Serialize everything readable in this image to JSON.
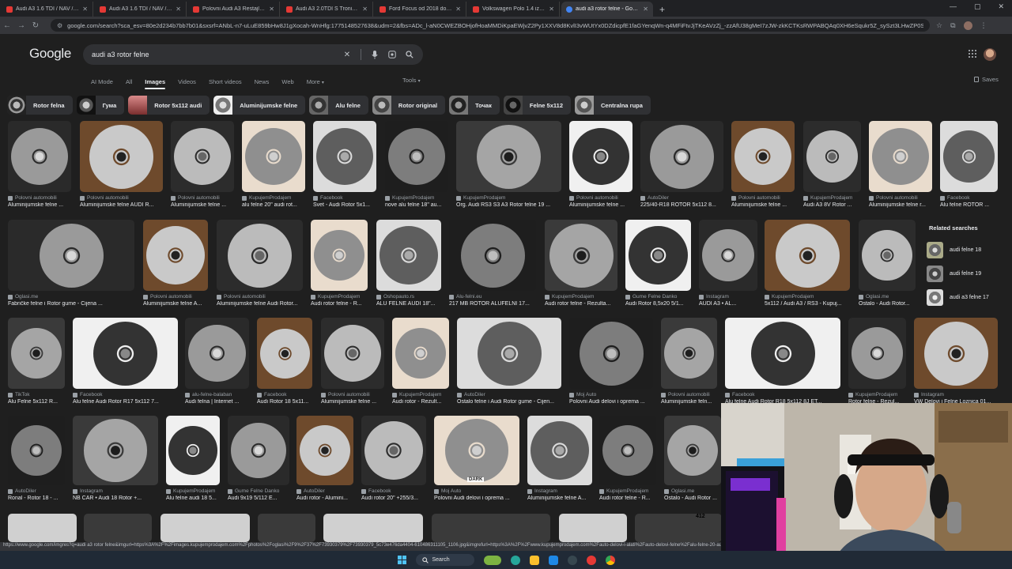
{
  "browser": {
    "tabs": [
      {
        "title": "Audi A3 1.6 TDI / NAV / XEN | P",
        "active": false
      },
      {
        "title": "Audi A3 1.6 TDI / NAV / XEN | P",
        "active": false
      },
      {
        "title": "Polovni Audi A3 Restajling 2019",
        "active": false
      },
      {
        "title": "Audi A3 2.0TDI S Tronic | Polov",
        "active": false
      },
      {
        "title": "Ford Focus od 2018 do 2024 | P",
        "active": false
      },
      {
        "title": "Volkswagen Polo 1.4 iz Nem ad",
        "active": false
      },
      {
        "title": "audi a3 rotor felne - Google Se",
        "active": true
      }
    ],
    "url": "google.com/search?sca_esv=80e2d234b7bb7b01&sxsrf=ANbL-n7-uLuE859bHw8J1gXocah-WnHfg:1775148527638&udm=2&fbs=ADc_l-aN0CWEZBOHjofHoaMMDiKpaEWjvZ2Py1XXV8d8KvlI3vWUtYx0DZdicpfE1faGYenqWn-q4MFiFtvJjTKeAVzZj_-zzAfU38gMeI7zJW-zkKCTKsRWPABQAq0XH6eSqukr5Z_sySzt3LHwZP0SOsVx43I12rWo_IK1Qfo6r2JPnSku",
    "status_url": "https://www.google.com/imgres?q=audi a3 rotor felne&imgurl=https%3A%2F%2Fimages.kupujemprodajem.com%2Fphotos%2Foglasi%2F9%2F37%2F73930379%2F73930379_5c73e476da4404-610486311105_1106.jpg&imgrefurl=https%3A%2F%2Fwww.kupujemprodajem.com%2Fauto-delovi-i-alati%2Fauto-delovi-felne%2Falu-felne-20-audi-rotor"
  },
  "google": {
    "logo": "Google",
    "query": "audi a3 rotor felne",
    "filters": [
      "AI Mode",
      "All",
      "Images",
      "Videos",
      "Short videos",
      "News",
      "Web",
      "More"
    ],
    "active_filter": "Images",
    "tools": "Tools",
    "saves": "Saves",
    "chips": [
      "Rotor felna",
      "Гума",
      "Rotor 5x112 audi",
      "Aluminijumske felne",
      "Alu felne",
      "Rotor original",
      "Точак",
      "Felne 5x112",
      "Centralna rupa"
    ],
    "related_title": "Related searches",
    "related": [
      "audi felne 18",
      "audi felne 19",
      "audi a3 felne 17"
    ]
  },
  "results": [
    {
      "src": "Polovni automobili",
      "title": "Aluminijumske felne ..."
    },
    {
      "src": "Polovni automobili",
      "title": "Aluminijumske felne AUDI R..."
    },
    {
      "src": "Polovni automobili",
      "title": "Aluminijumske felne ..."
    },
    {
      "src": "KupujemProdajem",
      "title": "alu felne 20\" audi rot..."
    },
    {
      "src": "Facebook",
      "title": "Svet - Audi Rotor 5x1..."
    },
    {
      "src": "KupujemProdajem",
      "title": "nove alu felne 18\" au..."
    },
    {
      "src": "KupujemProdajem",
      "title": "Org. Audi RS3 S3 A3 Rotor felne 19 ..."
    },
    {
      "src": "Polovni automobili",
      "title": "Aluminijumske felne ..."
    },
    {
      "src": "AutoDiler",
      "title": "225/40-R18 ROTOR 5x112 8..."
    },
    {
      "src": "Polovni automobili",
      "title": "Aluminijumske felne ..."
    },
    {
      "src": "KupujemProdajem",
      "title": "Audi A3 8V Rotor ..."
    },
    {
      "src": "Polovni automobili",
      "title": "Aluminijumske felne r..."
    },
    {
      "src": "Facebook",
      "title": "Alu felne ROTOR ..."
    },
    {
      "src": "Oglasi.me",
      "title": "Fabričke felne i Rotor gume - Cijena ..."
    },
    {
      "src": "Polovni automobili",
      "title": "Aluminijumske felne A..."
    },
    {
      "src": "Polovni automobili",
      "title": "Aluminijumske felne Audi Rotor..."
    },
    {
      "src": "KupujemProdajem",
      "title": "Audi rotor felne - R..."
    },
    {
      "src": "Oshopauto.rs",
      "title": "ALU FELNE AUDI 18\"..."
    },
    {
      "src": "Alu-felni.eu",
      "title": "217 MB ROTOR ALUFELNI 17..."
    },
    {
      "src": "KupujemProdajem",
      "title": "Audi rotor felne - Rezulta..."
    },
    {
      "src": "Gume Felne Danko",
      "title": "Audi Rotor 8,5x20 5/1..."
    },
    {
      "src": "Instagram",
      "title": "AUDI A3 • AL..."
    },
    {
      "src": "KupujemProdajem",
      "title": "5x112 / Audi A3 / RS3 - Kupuj..."
    },
    {
      "src": "Oglasi.me",
      "title": "Ostalo - Audi Rotor..."
    },
    {
      "src": "TikTok",
      "title": "Alu Felne 5x112 R..."
    },
    {
      "src": "Facebook",
      "title": "Alu felne Audi Rotor R17 5x112 7..."
    },
    {
      "src": "alu-felne-balaban",
      "title": "Audi felna | Internet ..."
    },
    {
      "src": "Facebook",
      "title": "Audi Rotor 18 5x11..."
    },
    {
      "src": "Polovni automobili",
      "title": "Aluminijumske felne ..."
    },
    {
      "src": "KupujemProdajem",
      "title": "Audi rotor - Rezult..."
    },
    {
      "src": "AutoDiler",
      "title": "Ostalo felne i Audi Rotor gume - Cijen..."
    },
    {
      "src": "Moj Auto",
      "title": "Polovni Audi delovi i oprema ..."
    },
    {
      "src": "Polovni automobili",
      "title": "Aluminijumske feln..."
    },
    {
      "src": "Facebook",
      "title": "Alu felne Audi Rotor R18 5x112 8J ET..."
    },
    {
      "src": "KupujemProdajem",
      "title": "Rotor felne - Rezul..."
    },
    {
      "src": "Instagram",
      "title": "VW Delovi i Felne Loznica 01..."
    },
    {
      "src": "AutoDiler",
      "title": "Ronal - Rotor 18 - ..."
    },
    {
      "src": "Instagram",
      "title": "NB CAR • Audi 18 Rotor +..."
    },
    {
      "src": "KupujemProdajem",
      "title": "Alu felne audi 18 5..."
    },
    {
      "src": "Gume Felne Danko",
      "title": "Audi 9x19 5/112 E..."
    },
    {
      "src": "AutoDiler",
      "title": "Audi rotor - Alumini..."
    },
    {
      "src": "Facebook",
      "title": "Audi rotor 20\" +255/3..."
    },
    {
      "src": "Moj Auto",
      "title": "Polovni Audi delovi i oprema ..."
    },
    {
      "src": "Instagram",
      "title": "Aluminijumske felne A..."
    },
    {
      "src": "KupujemProdajem",
      "title": "Audi rotor felne - R..."
    },
    {
      "src": "Oglasi.me",
      "title": "Ostalo - Audi Rotor ..."
    }
  ],
  "overlay_texts": {
    "dark_label": "DARK",
    "badge_412": "412"
  },
  "taskbar": {
    "search": "Search"
  },
  "colors": {
    "bg": "#1f1f1f",
    "chip": "#303134",
    "text": "#e8eaed",
    "muted": "#9aa0a6"
  }
}
